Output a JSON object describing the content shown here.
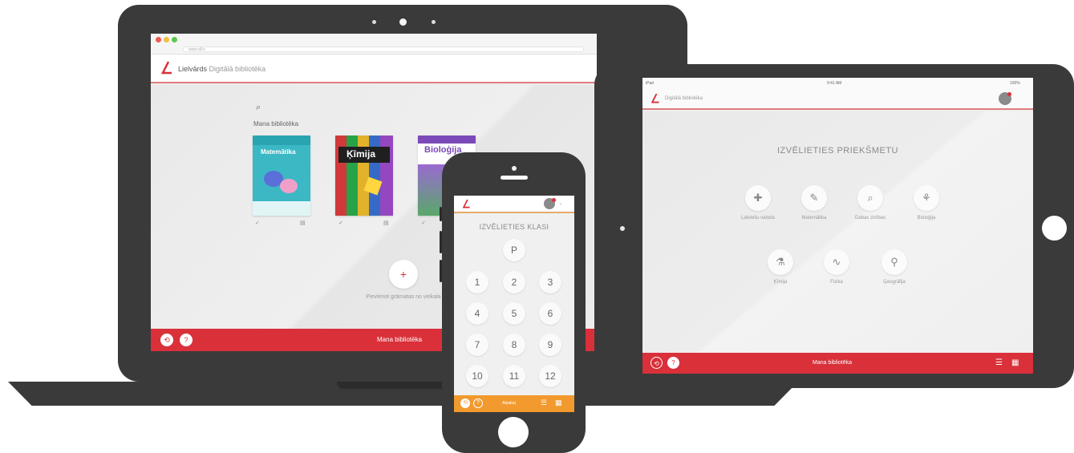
{
  "colors": {
    "accent_red": "#d9303a",
    "accent_orange": "#f29a2e",
    "device_body": "#3a3a3a"
  },
  "laptop": {
    "url": "www.dl.lv",
    "brand": {
      "name": "Lielvārds",
      "suffix": "Digitālā bibliotēka"
    },
    "library_title": "Mana bibliotēka",
    "books": [
      {
        "title": "Matemātika",
        "cover": "#3bb8c4"
      },
      {
        "title": "Ķīmija",
        "cover": "#2a2a2a"
      },
      {
        "title": "Bioloģija",
        "cover": "#ffffff"
      }
    ],
    "add_button_symbol": "+",
    "add_label": "Pievienot grāmatas no veikala",
    "footer_label": "Mana bibliotēka",
    "footer_icons": [
      "back-icon",
      "help-icon"
    ]
  },
  "tablet": {
    "status_left": "iPad",
    "status_time": "9:41 AM",
    "status_right": "100%",
    "brand_suffix": "Digitālā bibliotēka",
    "title": "IZVĒLIETIES PRIEKŠMETU",
    "subjects_row1": [
      {
        "label": "Latviešu valoda",
        "icon": "plus-cross-icon",
        "glyph": "✚"
      },
      {
        "label": "Matemātika",
        "icon": "compass-icon",
        "glyph": "✎"
      },
      {
        "label": "Dabas zinības",
        "icon": "magnifier-icon",
        "glyph": "⌕"
      },
      {
        "label": "Bioloģija",
        "icon": "plant-icon",
        "glyph": "⚘"
      }
    ],
    "subjects_row2": [
      {
        "label": "Ķīmija",
        "icon": "flask-icon",
        "glyph": "⚗"
      },
      {
        "label": "Fizika",
        "icon": "wave-icon",
        "glyph": "∿"
      },
      {
        "label": "Ģeogrāfija",
        "icon": "bulb-icon",
        "glyph": "⚲"
      }
    ],
    "footer_label": "Mana bibliotēka"
  },
  "phone": {
    "title": "IZVĒLIETIES KLASI",
    "grades": [
      "P",
      "1",
      "2",
      "3",
      "4",
      "5",
      "6",
      "7",
      "8",
      "9",
      "10",
      "11",
      "12"
    ],
    "footer_label": "Atpakaļ"
  }
}
